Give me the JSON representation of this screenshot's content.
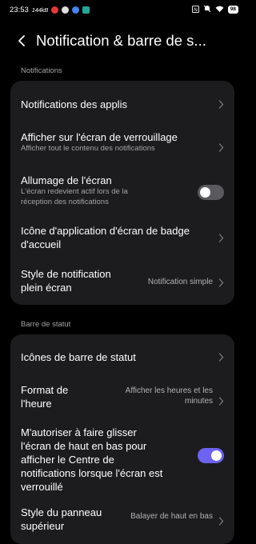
{
  "status_bar": {
    "time": "23:53",
    "network_speed": "144kB",
    "icons": [
      "youtube-icon",
      "circle-icon",
      "chrome-icon",
      "app-icon"
    ],
    "right_icons": [
      "nfc-icon",
      "mute-icon",
      "wifi-icon"
    ],
    "battery": "98"
  },
  "header": {
    "title": "Notification & barre de s..."
  },
  "sections": {
    "notifications_label": "Notifications",
    "status_bar_label": "Barre de statut"
  },
  "notifications": {
    "app_notifications": "Notifications des applis",
    "lock_screen": {
      "title": "Afficher sur l'écran de verrouillage",
      "subtitle": "Afficher tout le contenu des notifications"
    },
    "screen_on": {
      "title": "Allumage de l'écran",
      "subtitle_line1": "L'écran redevient actif lors de la",
      "subtitle_line2": "réception des notifications",
      "enabled": false
    },
    "badge": {
      "line1": "Icône d'application d'écran de badge",
      "line2": "d'accueil"
    },
    "fullscreen_style": {
      "line1": "Style de notification",
      "line2": "plein écran",
      "value": "Notification simple"
    }
  },
  "status": {
    "icons": "Icônes de barre de statut",
    "time_format": {
      "line1": "Format de",
      "line2": "l'heure",
      "value_line1": "Afficher les heures et les",
      "value_line2": "minutes"
    },
    "swipe": {
      "line1": "M'autoriser à faire glisser",
      "line2": "l'écran de haut en bas pour",
      "line3": "afficher le Centre de",
      "line4": "notifications lorsque l'écran est",
      "line5": "verrouillé",
      "enabled": true
    },
    "panel_style": {
      "line1": "Style du panneau",
      "line2": "supérieur",
      "value": "Balayer de haut en bas"
    }
  },
  "colors": {
    "accent": "#6c63f5",
    "card": "#1c1c1e",
    "background": "#000000"
  }
}
